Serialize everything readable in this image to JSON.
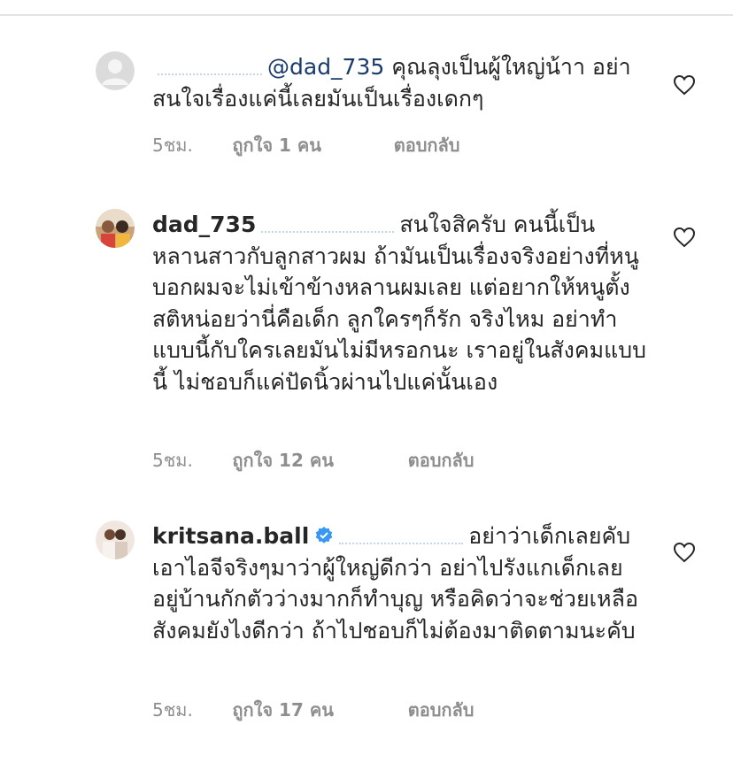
{
  "comments": [
    {
      "username": "",
      "mention": "@dad_735",
      "text": "คุณลุงเป็นผู้ใหญ่น้าา อย่าสนใจเรื่องแค่นี้เลยมันเป็นเรื่องเดกๆ",
      "time": "5ชม.",
      "likes": "ถูกใจ 1 คน",
      "reply": "ตอบกลับ",
      "avatar": "default-avatar-icon"
    },
    {
      "username": "dad_735",
      "mention": "",
      "text": "สนใจสิครับ คนนี้เป็นหลานสาวกับลูกสาวผม ถ้ามันเป็นเรื่องจริงอย่างที่หนูบอกผมจะไม่เข้าข้างหลานผมเลย แต่อยากให้หนูตั้งสติหน่อยว่านี่คือเด็ก ลูกใครๆก็รัก จริงไหม อย่าทำแบบนี้กับใครเลยมันไม่มีหรอกนะ เราอยู่ในสังคมแบบนี้ ไม่ชอบก็แค่ปัดนิ้วผ่านไปแค่นั้นเอง",
      "time": "5ชม.",
      "likes": "ถูกใจ 12 คน",
      "reply": "ตอบกลับ",
      "avatar": "profile-photo"
    },
    {
      "username": "kritsana.ball",
      "mention": "",
      "text": "อย่าว่าเด็กเลยคับ เอาไอจีจริงๆมาว่าผู้ใหญ่ดีกว่า อย่าไปรังแกเด็กเลย อยู่บ้านกักตัวว่างมากก็ทำบุญ หรือคิดว่าจะช่วยเหลือสังคมยังไงดีกว่า ถ้าไปชอบก็ไม่ต้องมาติดตามนะคับ",
      "time": "5ชม.",
      "likes": "ถูกใจ 17 คน",
      "reply": "ตอบกลับ",
      "avatar": "profile-photo",
      "verified": true
    }
  ],
  "colors": {
    "text": "#262626",
    "meta": "#8e8e8e",
    "mention": "#1a3a6b",
    "verified": "#3897f0",
    "heart_stroke": "#262626"
  }
}
